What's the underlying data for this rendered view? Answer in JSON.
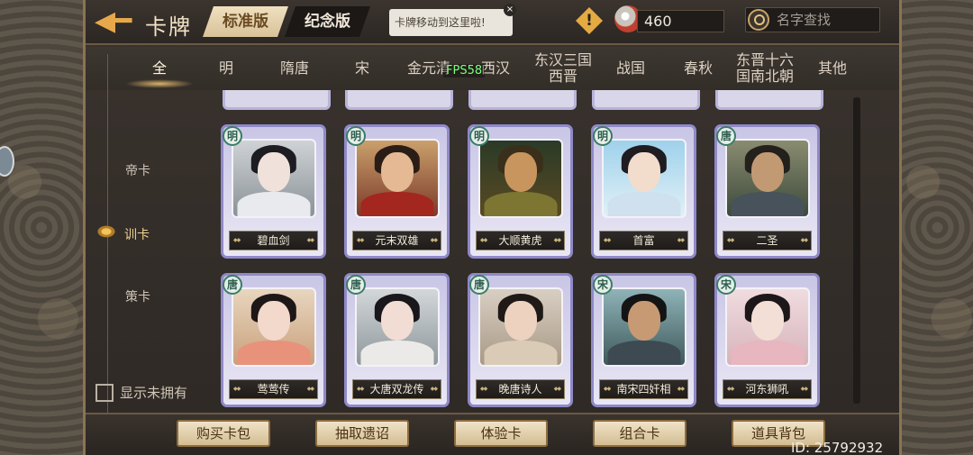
{
  "header": {
    "back_icon": "back-arrow-icon",
    "title": "卡牌",
    "version_tabs": [
      {
        "label": "标准版",
        "active": true
      },
      {
        "label": "纪念版",
        "active": false
      }
    ],
    "tooltip_text": "卡牌移动到这里啦!",
    "tooltip_close": "×",
    "warning_symbol": "!",
    "currency_icon": "feather-coin-icon",
    "currency_value": "460",
    "search_placeholder": "名字查找"
  },
  "era_tabs": [
    {
      "label": "全",
      "active": true
    },
    {
      "label": "明"
    },
    {
      "label": "隋唐"
    },
    {
      "label": "宋"
    },
    {
      "label": "金元清"
    },
    {
      "label": "西汉"
    },
    {
      "label": "东汉三国西晋"
    },
    {
      "label": "战国"
    },
    {
      "label": "春秋"
    },
    {
      "label": "东晋十六国南北朝"
    },
    {
      "label": "其他"
    }
  ],
  "fps": "FPS58",
  "categories": [
    {
      "label": "帝卡",
      "active": false
    },
    {
      "label": "训卡",
      "active": true
    },
    {
      "label": "策卡",
      "active": false
    }
  ],
  "show_unowned_label": "显示未拥有",
  "cards": [
    {
      "name": "碧血剑",
      "era": "明"
    },
    {
      "name": "元末双雄",
      "era": "明"
    },
    {
      "name": "大顺黄虎",
      "era": "明"
    },
    {
      "name": "首富",
      "era": "明"
    },
    {
      "name": "二圣",
      "era": "唐"
    },
    {
      "name": "莺莺传",
      "era": "唐"
    },
    {
      "name": "大唐双龙传",
      "era": "唐"
    },
    {
      "name": "晚唐诗人",
      "era": "唐"
    },
    {
      "name": "南宋四奸相",
      "era": "宋"
    },
    {
      "name": "河东狮吼",
      "era": "宋"
    }
  ],
  "bottom_buttons": [
    "购买卡包",
    "抽取遗诏",
    "体验卡",
    "组合卡",
    "道具背包"
  ],
  "user_id": "ID: 25792932",
  "colors": {
    "accent_gold": "#e7a84b",
    "card_border": "#8f89c8",
    "button_bg": "#e6d4b0"
  }
}
